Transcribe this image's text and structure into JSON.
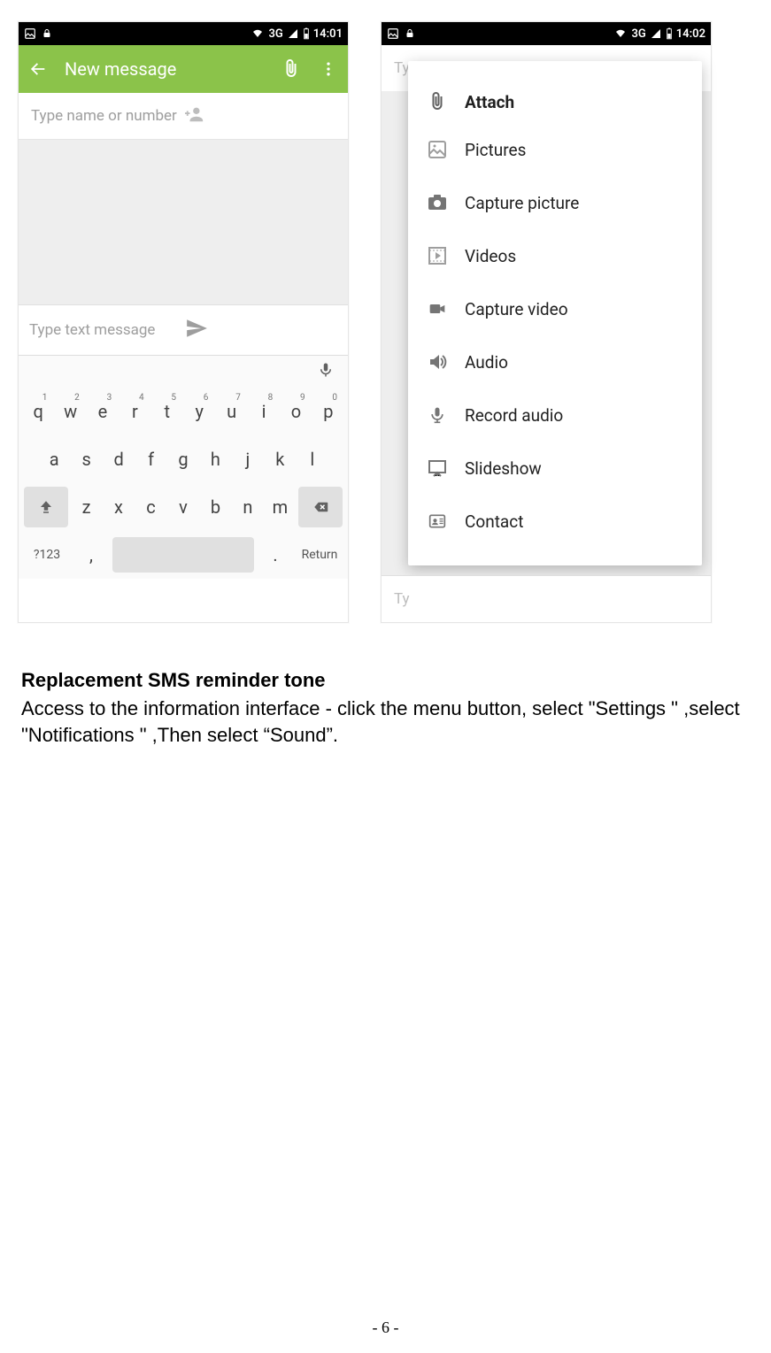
{
  "phone1": {
    "status": {
      "network": "3G",
      "time": "14:01"
    },
    "actionbar": {
      "title": "New message"
    },
    "recipient_placeholder": "Type name or number",
    "message_placeholder": "Type text message",
    "keyboard": {
      "row1": [
        {
          "k": "q",
          "n": "1"
        },
        {
          "k": "w",
          "n": "2"
        },
        {
          "k": "e",
          "n": "3"
        },
        {
          "k": "r",
          "n": "4"
        },
        {
          "k": "t",
          "n": "5"
        },
        {
          "k": "y",
          "n": "6"
        },
        {
          "k": "u",
          "n": "7"
        },
        {
          "k": "i",
          "n": "8"
        },
        {
          "k": "o",
          "n": "9"
        },
        {
          "k": "p",
          "n": "0"
        }
      ],
      "row2": [
        "a",
        "s",
        "d",
        "f",
        "g",
        "h",
        "j",
        "k",
        "l"
      ],
      "row3": [
        "z",
        "x",
        "c",
        "v",
        "b",
        "n",
        "m"
      ],
      "sym": "?123",
      "comma": ",",
      "period": ".",
      "return": "Return"
    }
  },
  "phone2": {
    "status": {
      "network": "3G",
      "time": "14:02"
    },
    "dim_recipient": "Ty",
    "dim_message": "Ty",
    "attach": {
      "header": "Attach",
      "items": [
        "Pictures",
        "Capture picture",
        "Videos",
        "Capture video",
        "Audio",
        "Record audio",
        "Slideshow",
        "Contact"
      ]
    }
  },
  "doc": {
    "heading": "Replacement SMS reminder tone",
    "para": "Access to the information interface - click the menu button, select \"Settings \" ,select \"Notifications \" ,Then select “Sound”.",
    "page_num": "- 6 -"
  }
}
